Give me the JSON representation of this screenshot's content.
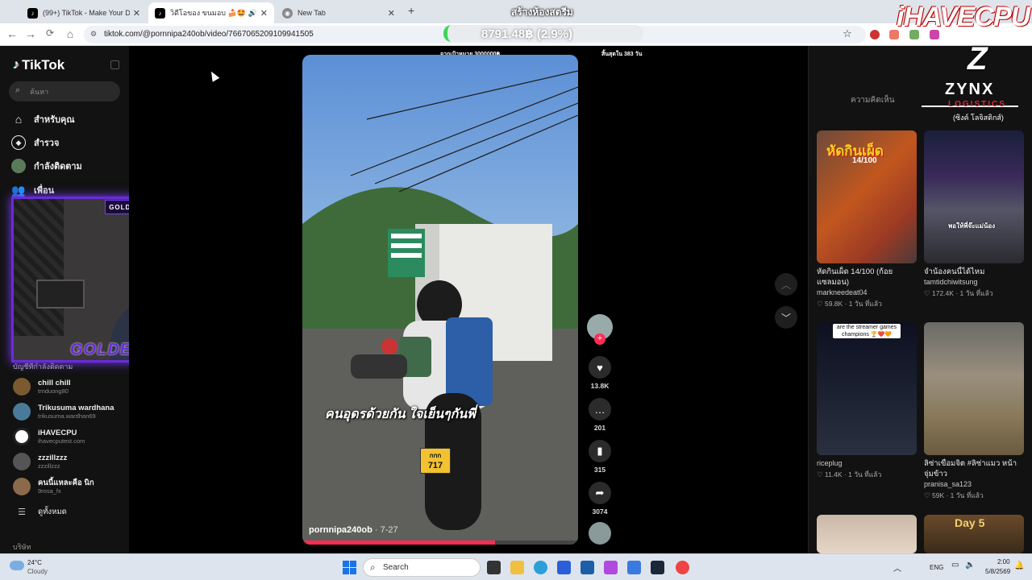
{
  "browser": {
    "tabs": [
      {
        "title": "(99+) TikTok - Make Your Day",
        "active": false
      },
      {
        "title": "วิดีโอของ ขนมอบ 🍰🤩 (@po",
        "active": true
      },
      {
        "title": "New Tab",
        "active": false
      }
    ],
    "new_tab": "+",
    "url": "tiktok.com/@pornnipa240ob/video/7667065209109941505",
    "reload": "⟳",
    "back": "←",
    "forward": "→",
    "home": "⌂",
    "star": "☆"
  },
  "stream_overlay": {
    "title": "สร้างห้องสตรีม",
    "balance": "8791.48฿ (2.9%)",
    "goal": "จากเป้าหมาย 3000000฿",
    "days_left": "สิ้นสุดใน 383 วัน",
    "brand": "iHAVECPU",
    "sponsor_letter": "Z",
    "sponsor_name": "ZYNX",
    "sponsor_sub": "LOGISTICS",
    "sponsor_thai": "(ซิงค์ โลจิสติกส์)",
    "cam_label": "GOLDENJET_TV",
    "cam_banner": "GOLDENJET"
  },
  "sidebar": {
    "logo": "TikTok",
    "search_placeholder": "ค้นหา",
    "nav": [
      {
        "label": "สำหรับคุณ",
        "icon": "home-icon"
      },
      {
        "label": "สำรวจ",
        "icon": "compass-icon"
      },
      {
        "label": "กำลังติดตาม",
        "icon": "following-avatar"
      },
      {
        "label": "เพื่อน",
        "icon": "friends-icon"
      }
    ],
    "following_label": "บัญชีที่กำลังติดตาม",
    "accounts": [
      {
        "name": "chill chill",
        "handle": "trnduong80",
        "color": "#7a5a2e"
      },
      {
        "name": "Trikusuma wardhana",
        "handle": "trikusuma.wardhan69",
        "color": "#4a7a9a"
      },
      {
        "name": "iHAVECPU",
        "handle": "ihavecputest.com",
        "color": "#ffffff"
      },
      {
        "name": "zzzillzzz",
        "handle": "zzzillzzz",
        "color": "#555555"
      },
      {
        "name": "คนนี้แหละคือ นิก",
        "handle": "9rosa_fx",
        "color": "#8a6a4a"
      }
    ],
    "see_all": "ดูทั้งหมด",
    "company": "บริษัท"
  },
  "video": {
    "caption": "คนอุดรด้วยกัน ใจเย็นๆกันพี่",
    "author": "pornnipa240ob",
    "date": "· 7-27",
    "plate_top": "กกก",
    "plate_num": "717",
    "progress": 0.7
  },
  "actions": {
    "likes": "13.8K",
    "comments": "201",
    "saves": "315",
    "shares": "3074"
  },
  "right_panel": {
    "tab_comments": "ความคิดเห็น",
    "cards": [
      {
        "caption": "หัดกินเผ็ด 14/100 (ก้อยแซลมอน)",
        "user": "markneedeat04",
        "likes": "59.8K",
        "time": "· 1 วัน ที่แล้ว",
        "overlay": "หัดกินเผ็ด",
        "overlay2": "14/100"
      },
      {
        "caption": "จำน้องคนนี้ได้ไหม",
        "user": "tamtidchiwitsung",
        "likes": "172.4K",
        "time": "· 1 วัน ที่แล้ว",
        "overlay": "พอให้พี่จ๊ะแม่น้อง",
        "overlay2": ""
      },
      {
        "caption": "",
        "user": "riceplug",
        "likes": "11.4K",
        "time": "· 1 วัน ที่แล้ว",
        "overlay": "are the streamer games champions 🏆❤️🧡",
        "overlay2": ""
      },
      {
        "caption": "ลิซ่าเขื่อมจิต #ลิซ่าแมว หน้าจุ่มข้าว",
        "user": "pranisa_sa123",
        "likes": "59K",
        "time": "· 1 วัน ที่แล้ว",
        "overlay": "",
        "overlay2": ""
      },
      {
        "caption": "",
        "user": "",
        "likes": "",
        "time": "",
        "overlay": "",
        "overlay2": ""
      },
      {
        "caption": "",
        "user": "",
        "likes": "",
        "time": "",
        "overlay": "Day 5",
        "overlay2": ""
      }
    ]
  },
  "taskbar": {
    "temp": "24°C",
    "weather": "Cloudy",
    "search": "Search",
    "lang": "ENG",
    "time": "2:00",
    "date": "5/8/2569"
  }
}
